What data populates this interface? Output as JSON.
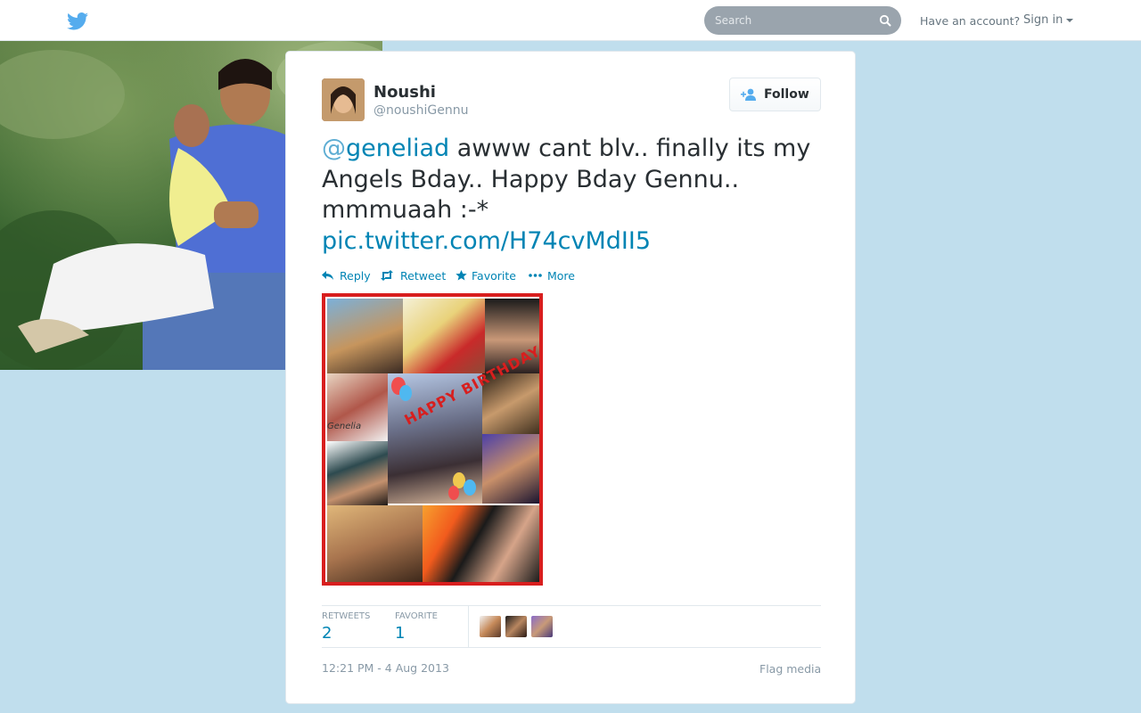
{
  "topbar": {
    "logo_icon": "twitter-bird-icon",
    "search_placeholder": "Search",
    "account_prompt": "Have an account?",
    "signin_label": "Sign in"
  },
  "tweet": {
    "author_name": "Noushi",
    "author_handle": "@noushiGennu",
    "follow_label": "Follow",
    "mention_at": "@",
    "mention_name": "geneliad",
    "text_body": " awww cant blv.. finally its my Angels Bday.. Happy Bday Gennu.. mmmuaah :-*",
    "link": "pic.twitter.com/H74cvMdII5",
    "actions": [
      "Reply",
      "Retweet",
      "Favorite",
      "More"
    ],
    "media_text": {
      "banner": "HAPPY BIRTHDAY",
      "signature": "Genelia"
    },
    "stats": {
      "retweets_label": "RETWEETS",
      "retweets_count": "2",
      "favorites_label": "FAVORITE",
      "favorites_count": "1"
    },
    "timestamp": "12:21 PM - 4 Aug 2013",
    "flag_label": "Flag media"
  },
  "colors": {
    "background": "#c0deed",
    "link": "#0084b4",
    "twitter_blue": "#55acee",
    "media_border": "#d81e1e"
  }
}
